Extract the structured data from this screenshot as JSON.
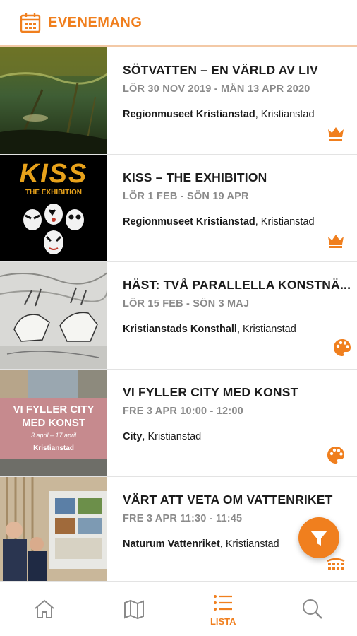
{
  "header": {
    "title": "EVENEMANG",
    "icon": "calendar-icon"
  },
  "events": [
    {
      "title": "SÖTVATTEN – EN VÄRLD AV LIV",
      "date": "LÖR 30 NOV 2019 - MÅN 13 APR 2020",
      "venue": "Regionmuseet Kristianstad",
      "city": ", Kristianstad",
      "category_icon": "crown-icon"
    },
    {
      "title": "KISS – THE EXHIBITION",
      "date": "LÖR 1 FEB - SÖN 19 APR",
      "venue": "Regionmuseet Kristianstad",
      "city": ", Kristianstad",
      "category_icon": "crown-icon",
      "thumb_text": {
        "logo": "KISS",
        "sub": "THE EXHIBITION"
      }
    },
    {
      "title": "HÄST: TVÅ PARALLELLA KONSTNÄ...",
      "date": "LÖR 15 FEB - SÖN 3 MAJ",
      "venue": "Kristianstads Konsthall",
      "city": ", Kristianstad",
      "category_icon": "palette-icon"
    },
    {
      "title": "VI FYLLER CITY MED KONST",
      "date": "FRE 3 APR 10:00 - 12:00",
      "venue": "City",
      "city": ", Kristianstad",
      "category_icon": "palette-icon",
      "thumb_text": {
        "line1": "VI FYLLER CITY",
        "line2": "MED KONST",
        "line3": "3 april – 17 april",
        "brand": "Kristianstad"
      }
    },
    {
      "title": "VÄRT ATT VETA OM VATTENRIKET",
      "date": "FRE 3 APR 11:30 - 11:45",
      "venue": "Naturum Vattenriket",
      "city": ", Kristianstad",
      "category_icon": "theater-icon"
    }
  ],
  "tabs": [
    {
      "label": "",
      "icon": "home-icon"
    },
    {
      "label": "",
      "icon": "map-icon"
    },
    {
      "label": "LISTA",
      "icon": "list-icon",
      "active": true
    },
    {
      "label": "",
      "icon": "search-icon"
    }
  ],
  "colors": {
    "accent": "#f07f1e",
    "text": "#1c1c1c",
    "muted": "#8a8a8a"
  }
}
